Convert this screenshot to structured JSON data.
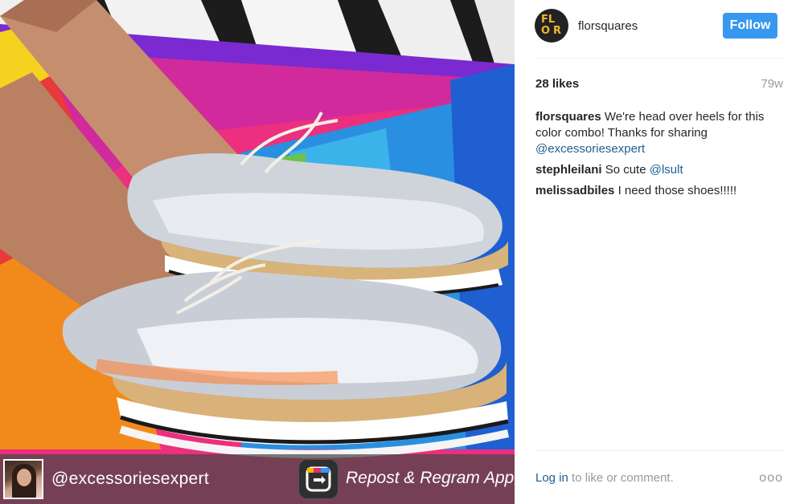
{
  "post": {
    "author": "florsquares",
    "follow_label": "Follow",
    "likes": "28 likes",
    "age": "79w",
    "avatar_letters": [
      "FL",
      "O",
      "R"
    ]
  },
  "caption": {
    "user": "florsquares",
    "text": "We're head over heels for this color combo! Thanks for sharing",
    "mention": "@excessoriesexpert"
  },
  "comments": [
    {
      "user": "stephleilani",
      "text": "So cute",
      "mention": "@lsult"
    },
    {
      "user": "melissadbiles",
      "text": "I need those shoes!!!!!",
      "mention": ""
    }
  ],
  "footer": {
    "login": "Log in",
    "rest": "to like or comment.",
    "more": "ooo"
  },
  "repost": {
    "user": "@excessoriesexpert",
    "app": "Repost & Regram App"
  },
  "colors": {
    "follow": "#3897f0",
    "link": "#1e5f91",
    "muted": "#999999"
  }
}
